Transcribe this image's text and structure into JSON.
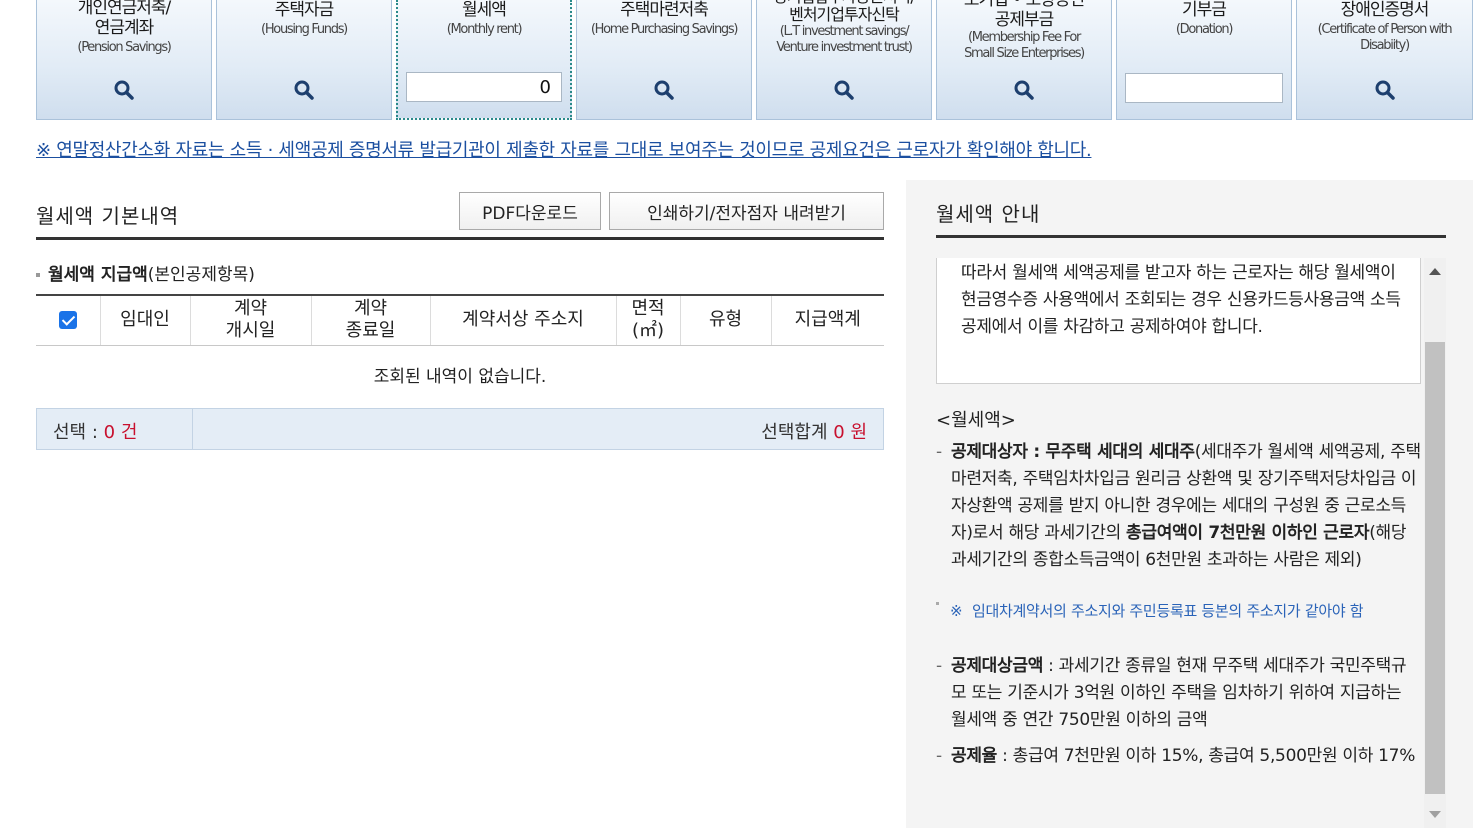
{
  "tiles": [
    {
      "title": "개인연금저축/\n연금계좌",
      "sub": "(Pension Savings)",
      "icon": "magnifier-icon"
    },
    {
      "title": "주택자금",
      "sub": "(Housing Funds)",
      "icon": "magnifier-icon"
    },
    {
      "title": "월세액",
      "sub": "(Monthly rent)",
      "input": "0"
    },
    {
      "title": "주택마련저축",
      "sub": "(Home Purchasing Savings)",
      "icon": "magnifier-icon"
    },
    {
      "title": "장기집합투자증권저축/\n벤처기업투자신탁",
      "sub": "(L.T investment savings/\nVenture investment trust)",
      "icon": "magnifier-icon"
    },
    {
      "title": "소기업 • 소상공인\n공제부금",
      "sub": "(Membership Fee For\nSmall Size Enterprises)",
      "icon": "magnifier-icon"
    },
    {
      "title": "기부금",
      "sub": "(Donation)",
      "input": ""
    },
    {
      "title": "장애인증명서",
      "sub": "(Certificate of Person with\nDisabiity)",
      "icon": "magnifier-icon"
    }
  ],
  "notice": "※ 연말정산간소화 자료는 소득 · 세액공제 증명서류 발급기관이 제출한 자료를 그대로 보여주는 것이므로 공제요건은 근로자가 확인해야 합니다.",
  "main": {
    "title": "월세액 기본내역",
    "pdf_button": "PDF다운로드",
    "print_button": "인쇄하기/전자점자 내려받기",
    "sub_title_bold": "월세액 지급액",
    "sub_title_rest": "(본인공제항목)",
    "columns": [
      "임대인",
      "계약\n개시일",
      "계약\n종료일",
      "계약서상 주소지",
      "면적\n(㎡)",
      "유형",
      "지급액계"
    ],
    "empty_text": "조회된 내역이 없습니다.",
    "summary": {
      "select_label": "선택 : ",
      "select_count": "0 건",
      "total_label": "선택합계 ",
      "total_value": "0 원"
    }
  },
  "guide": {
    "title": "월세액 안내",
    "intro": "따라서 월세액 세액공제를 받고자 하는 근로자는 해당 월세액이 현금영수증 사용액에서 조회되는 경우 신용카드등사용금액 소득공제에서 이를 차감하고 공제하여야 합니다.",
    "section_head": "<월세액>",
    "item1_bold1": "공제대상자 : 무주택 세대의 세대주",
    "item1_text1": "(세대주가 월세액 세액공제, 주택마련저축, 주택임차차입금 원리금 상환액 및 장기주택저당차입금 이자상환액 공제를 받지 아니한 경우에는 세대의 구성원 중 근로소득자)로서 해당 과세기간의 ",
    "item1_bold2": "총급여액이 7천만원 이하인 근로자",
    "item1_text2": "(해당 과세기간의 종합소득금액이 6천만원 초과하는 사람은 제외)",
    "note_mark": "※",
    "note_text": "임대차계약서의 주소지와 주민등록표 등본의 주소지가 같아야 함",
    "item2_bold": "공제대상금액",
    "item2_text": " : 과세기간 종류일 현재 무주택 세대주가 국민주택규모 또는 기준시가 3억원 이하인 주택을 임차하기 위하여 지급하는 월세액 중 연간 750만원 이하의 금액",
    "item3_bold": "공제율",
    "item3_text": " : 총급여 7천만원 이하 15%, 총급여 5,500만원 이하 17%"
  },
  "colors": {
    "link": "#1b4fa0",
    "accent_red": "#c8102e",
    "tile_border": "#aac2da",
    "note_blue": "#2a63b8"
  }
}
